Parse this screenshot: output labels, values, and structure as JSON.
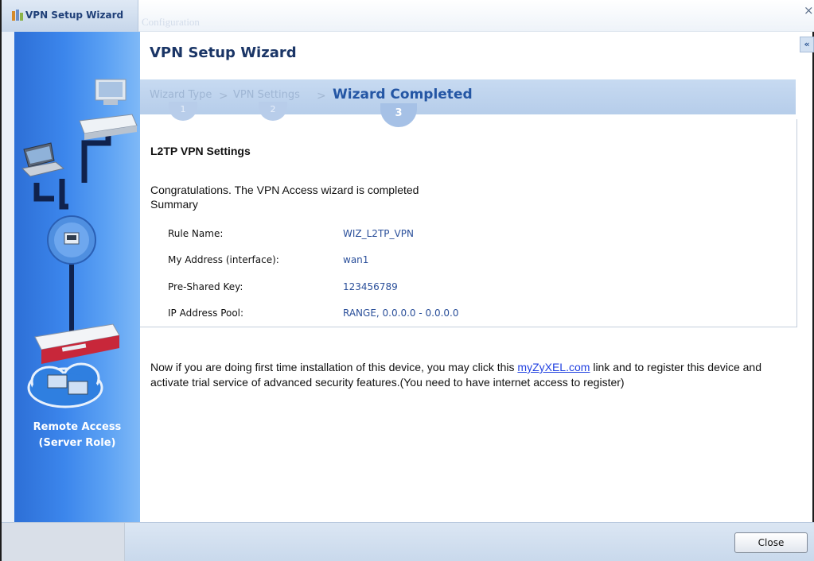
{
  "window": {
    "title": "VPN Setup Wizard",
    "ghost_tab": "Configuration",
    "close_glyph": "×",
    "collapse_glyph": "«"
  },
  "sidebar": {
    "label_line1": "Remote Access",
    "label_line2": "(Server Role)",
    "accent_color": "#3c86ec"
  },
  "main": {
    "title": "VPN Setup Wizard",
    "steps": [
      {
        "label": "Wizard Type",
        "number": "1",
        "active": false
      },
      {
        "label": "VPN Settings",
        "number": "2",
        "active": false
      },
      {
        "label": "Wizard Completed",
        "number": "3",
        "active": true
      }
    ],
    "step_separator": ">",
    "section_title": "L2TP VPN Settings",
    "congrats_line1": "Congratulations. The VPN Access wizard is completed",
    "congrats_line2": "Summary",
    "summary": [
      {
        "key": "Rule Name:",
        "value": "WIZ_L2TP_VPN"
      },
      {
        "key": "My Address (interface):",
        "value": "wan1"
      },
      {
        "key": "Pre-Shared Key:",
        "value": "123456789"
      },
      {
        "key": "IP Address Pool:",
        "value": "RANGE, 0.0.0.0 - 0.0.0.0"
      }
    ],
    "notice_before_link": "Now if you are doing first time installation of this device, you may click this ",
    "notice_link": "myZyXEL.com",
    "notice_after_link": " link and to register this device and activate trial service of advanced security features.(You need to have internet access to register)"
  },
  "footer": {
    "close_label": "Close"
  },
  "icons": [
    "wizard-icon",
    "monitor-icon",
    "switch-icon",
    "laptop-icon",
    "network-globe-icon",
    "firewall-device-icon",
    "cloud-network-icon"
  ]
}
